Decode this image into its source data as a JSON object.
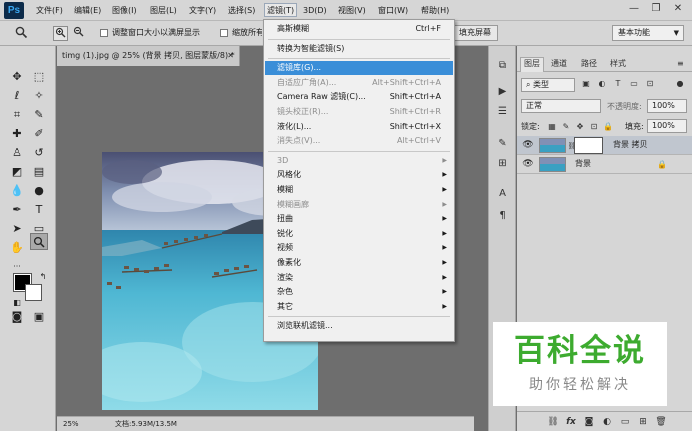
{
  "app": {
    "logo": "Ps"
  },
  "menubar": {
    "items": [
      "文件(F)",
      "编辑(E)",
      "图像(I)",
      "图层(L)",
      "文字(Y)",
      "选择(S)",
      "滤镜(T)",
      "3D(D)",
      "视图(V)",
      "窗口(W)",
      "帮助(H)"
    ],
    "active": "滤镜(T)"
  },
  "window_controls": {
    "minimize": "—",
    "restore": "❐",
    "close": "✕"
  },
  "options_bar": {
    "zoom_in": "🔍",
    "check1_label": "调整窗口大小以满屏显示",
    "check2_label": "缩放所有窗口",
    "fill_screen": "填充屏幕",
    "workspace": "基本功能"
  },
  "document": {
    "tab_title": "timg (1).jpg @ 25% (背景 拷贝, 图层蒙版/8) *",
    "zoom": "25%",
    "doc_info": "文档:5.93M/13.5M"
  },
  "filter_menu": {
    "items": [
      {
        "label": "高斯模糊",
        "shortcut": "Ctrl+F",
        "state": "normal",
        "submenu": false
      },
      {
        "sep": true
      },
      {
        "label": "转换为智能滤镜(S)",
        "shortcut": "",
        "state": "normal",
        "submenu": false
      },
      {
        "sep": true
      },
      {
        "label": "滤镜库(G)...",
        "shortcut": "",
        "state": "highlighted",
        "submenu": false
      },
      {
        "label": "自适应广角(A)...",
        "shortcut": "Alt+Shift+Ctrl+A",
        "state": "disabled",
        "submenu": false
      },
      {
        "label": "Camera Raw 滤镜(C)...",
        "shortcut": "Shift+Ctrl+A",
        "state": "normal",
        "submenu": false
      },
      {
        "label": "镜头校正(R)...",
        "shortcut": "Shift+Ctrl+R",
        "state": "disabled",
        "submenu": false
      },
      {
        "label": "液化(L)...",
        "shortcut": "Shift+Ctrl+X",
        "state": "normal",
        "submenu": false
      },
      {
        "label": "消失点(V)...",
        "shortcut": "Alt+Ctrl+V",
        "state": "disabled",
        "submenu": false
      },
      {
        "sep": true
      },
      {
        "label": "3D",
        "shortcut": "",
        "state": "disabled",
        "submenu": true
      },
      {
        "label": "风格化",
        "shortcut": "",
        "state": "normal",
        "submenu": true
      },
      {
        "label": "模糊",
        "shortcut": "",
        "state": "normal",
        "submenu": true
      },
      {
        "label": "模糊画廊",
        "shortcut": "",
        "state": "disabled",
        "submenu": true
      },
      {
        "label": "扭曲",
        "shortcut": "",
        "state": "normal",
        "submenu": true
      },
      {
        "label": "锐化",
        "shortcut": "",
        "state": "normal",
        "submenu": true
      },
      {
        "label": "视频",
        "shortcut": "",
        "state": "normal",
        "submenu": true
      },
      {
        "label": "像素化",
        "shortcut": "",
        "state": "normal",
        "submenu": true
      },
      {
        "label": "渲染",
        "shortcut": "",
        "state": "normal",
        "submenu": true
      },
      {
        "label": "杂色",
        "shortcut": "",
        "state": "normal",
        "submenu": true
      },
      {
        "label": "其它",
        "shortcut": "",
        "state": "normal",
        "submenu": true
      },
      {
        "sep": true
      },
      {
        "label": "浏览联机滤镜...",
        "shortcut": "",
        "state": "normal",
        "submenu": false
      }
    ]
  },
  "layers_panel": {
    "tabs": [
      "图层",
      "通道",
      "路径",
      "样式"
    ],
    "active_tab": "图层",
    "kind_filter": "类型",
    "blend_mode": "正常",
    "opacity_label": "不透明度:",
    "opacity": "100%",
    "lock_label": "锁定:",
    "fill_label": "填充:",
    "fill": "100%",
    "layers": [
      {
        "name": "背景 拷贝",
        "selected": true,
        "has_mask": true,
        "locked": false
      },
      {
        "name": "背景",
        "selected": false,
        "has_mask": false,
        "locked": true
      }
    ],
    "bottom_icons": [
      "link-icon",
      "fx-icon",
      "mask-icon",
      "adjustment-icon",
      "group-icon",
      "new-layer-icon",
      "trash-icon"
    ],
    "fx_label": "fx"
  },
  "watermark": {
    "title": "百科全说",
    "subtitle": "助你轻松解决"
  },
  "colors": {
    "accent": "#3a8ed8",
    "watermark_green": "#3dab2f",
    "foreground": "#000000",
    "background": "#ffffff"
  }
}
